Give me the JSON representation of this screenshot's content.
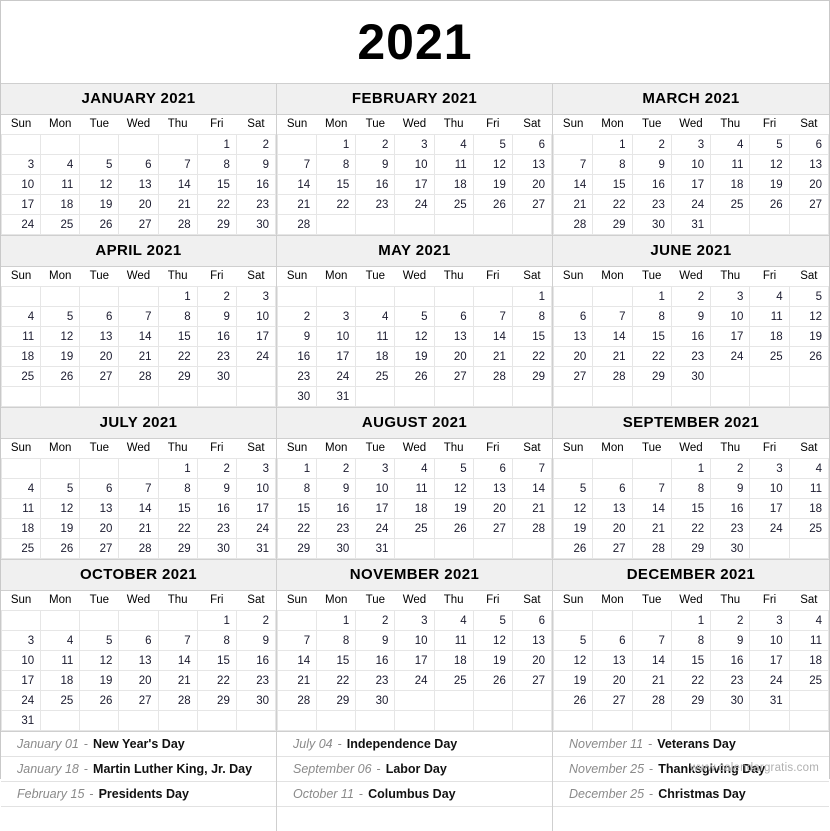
{
  "year_title": "2021",
  "footer": "www.calendargratis.com",
  "weekdays": [
    "Sun",
    "Mon",
    "Tue",
    "Wed",
    "Thu",
    "Fri",
    "Sat"
  ],
  "colors": {
    "header_band": "#f0f0f0",
    "cell_border": "#e6e6e6",
    "month_border": "#cfcfcf",
    "holiday_date": "#8a8a8a",
    "holiday_name": "#111111",
    "footer_text": "#b0b0b0"
  },
  "quarters": [
    {
      "months": [
        {
          "title": "JANUARY 2021",
          "weeks": [
            [
              "",
              "",
              "",
              "",
              "",
              "1",
              "2"
            ],
            [
              "3",
              "4",
              "5",
              "6",
              "7",
              "8",
              "9"
            ],
            [
              "10",
              "11",
              "12",
              "13",
              "14",
              "15",
              "16"
            ],
            [
              "17",
              "18",
              "19",
              "20",
              "21",
              "22",
              "23"
            ],
            [
              "24",
              "25",
              "26",
              "27",
              "28",
              "29",
              "30"
            ]
          ]
        },
        {
          "title": "FEBRUARY 2021",
          "weeks": [
            [
              "",
              "1",
              "2",
              "3",
              "4",
              "5",
              "6"
            ],
            [
              "7",
              "8",
              "9",
              "10",
              "11",
              "12",
              "13"
            ],
            [
              "14",
              "15",
              "16",
              "17",
              "18",
              "19",
              "20"
            ],
            [
              "21",
              "22",
              "23",
              "24",
              "25",
              "26",
              "27"
            ],
            [
              "28",
              "",
              "",
              "",
              "",
              "",
              ""
            ]
          ]
        },
        {
          "title": "MARCH 2021",
          "weeks": [
            [
              "",
              "1",
              "2",
              "3",
              "4",
              "5",
              "6"
            ],
            [
              "7",
              "8",
              "9",
              "10",
              "11",
              "12",
              "13"
            ],
            [
              "14",
              "15",
              "16",
              "17",
              "18",
              "19",
              "20"
            ],
            [
              "21",
              "22",
              "23",
              "24",
              "25",
              "26",
              "27"
            ],
            [
              "28",
              "29",
              "30",
              "31",
              "",
              "",
              ""
            ]
          ]
        }
      ]
    },
    {
      "months": [
        {
          "title": "APRIL 2021",
          "weeks": [
            [
              "",
              "",
              "",
              "",
              "1",
              "2",
              "3"
            ],
            [
              "4",
              "5",
              "6",
              "7",
              "8",
              "9",
              "10"
            ],
            [
              "11",
              "12",
              "13",
              "14",
              "15",
              "16",
              "17"
            ],
            [
              "18",
              "19",
              "20",
              "21",
              "22",
              "23",
              "24"
            ],
            [
              "25",
              "26",
              "27",
              "28",
              "29",
              "30",
              ""
            ],
            [
              "",
              "",
              "",
              "",
              "",
              "",
              ""
            ]
          ]
        },
        {
          "title": "MAY 2021",
          "weeks": [
            [
              "",
              "",
              "",
              "",
              "",
              "",
              "1"
            ],
            [
              "2",
              "3",
              "4",
              "5",
              "6",
              "7",
              "8"
            ],
            [
              "9",
              "10",
              "11",
              "12",
              "13",
              "14",
              "15"
            ],
            [
              "16",
              "17",
              "18",
              "19",
              "20",
              "21",
              "22"
            ],
            [
              "23",
              "24",
              "25",
              "26",
              "27",
              "28",
              "29"
            ],
            [
              "30",
              "31",
              "",
              "",
              "",
              "",
              ""
            ]
          ]
        },
        {
          "title": "JUNE 2021",
          "weeks": [
            [
              "",
              "",
              "1",
              "2",
              "3",
              "4",
              "5"
            ],
            [
              "6",
              "7",
              "8",
              "9",
              "10",
              "11",
              "12"
            ],
            [
              "13",
              "14",
              "15",
              "16",
              "17",
              "18",
              "19"
            ],
            [
              "20",
              "21",
              "22",
              "23",
              "24",
              "25",
              "26"
            ],
            [
              "27",
              "28",
              "29",
              "30",
              "",
              "",
              ""
            ],
            [
              "",
              "",
              "",
              "",
              "",
              "",
              ""
            ]
          ]
        }
      ]
    },
    {
      "months": [
        {
          "title": "JULY 2021",
          "weeks": [
            [
              "",
              "",
              "",
              "",
              "1",
              "2",
              "3"
            ],
            [
              "4",
              "5",
              "6",
              "7",
              "8",
              "9",
              "10"
            ],
            [
              "11",
              "12",
              "13",
              "14",
              "15",
              "16",
              "17"
            ],
            [
              "18",
              "19",
              "20",
              "21",
              "22",
              "23",
              "24"
            ],
            [
              "25",
              "26",
              "27",
              "28",
              "29",
              "30",
              "31"
            ]
          ]
        },
        {
          "title": "AUGUST 2021",
          "weeks": [
            [
              "1",
              "2",
              "3",
              "4",
              "5",
              "6",
              "7"
            ],
            [
              "8",
              "9",
              "10",
              "11",
              "12",
              "13",
              "14"
            ],
            [
              "15",
              "16",
              "17",
              "18",
              "19",
              "20",
              "21"
            ],
            [
              "22",
              "23",
              "24",
              "25",
              "26",
              "27",
              "28"
            ],
            [
              "29",
              "30",
              "31",
              "",
              "",
              "",
              ""
            ]
          ]
        },
        {
          "title": "SEPTEMBER 2021",
          "weeks": [
            [
              "",
              "",
              "",
              "1",
              "2",
              "3",
              "4"
            ],
            [
              "5",
              "6",
              "7",
              "8",
              "9",
              "10",
              "11"
            ],
            [
              "12",
              "13",
              "14",
              "15",
              "16",
              "17",
              "18"
            ],
            [
              "19",
              "20",
              "21",
              "22",
              "23",
              "24",
              "25"
            ],
            [
              "26",
              "27",
              "28",
              "29",
              "30",
              "",
              ""
            ]
          ]
        }
      ]
    },
    {
      "months": [
        {
          "title": "OCTOBER 2021",
          "weeks": [
            [
              "",
              "",
              "",
              "",
              "",
              "1",
              "2"
            ],
            [
              "3",
              "4",
              "5",
              "6",
              "7",
              "8",
              "9"
            ],
            [
              "10",
              "11",
              "12",
              "13",
              "14",
              "15",
              "16"
            ],
            [
              "17",
              "18",
              "19",
              "20",
              "21",
              "22",
              "23"
            ],
            [
              "24",
              "25",
              "26",
              "27",
              "28",
              "29",
              "30"
            ],
            [
              "31",
              "",
              "",
              "",
              "",
              "",
              ""
            ]
          ]
        },
        {
          "title": "NOVEMBER 2021",
          "weeks": [
            [
              "",
              "1",
              "2",
              "3",
              "4",
              "5",
              "6"
            ],
            [
              "7",
              "8",
              "9",
              "10",
              "11",
              "12",
              "13"
            ],
            [
              "14",
              "15",
              "16",
              "17",
              "18",
              "19",
              "20"
            ],
            [
              "21",
              "22",
              "23",
              "24",
              "25",
              "26",
              "27"
            ],
            [
              "28",
              "29",
              "30",
              "",
              "",
              "",
              ""
            ],
            [
              "",
              "",
              "",
              "",
              "",
              "",
              ""
            ]
          ]
        },
        {
          "title": "DECEMBER 2021",
          "weeks": [
            [
              "",
              "",
              "",
              "1",
              "2",
              "3",
              "4"
            ],
            [
              "5",
              "6",
              "7",
              "8",
              "9",
              "10",
              "11"
            ],
            [
              "12",
              "13",
              "14",
              "15",
              "16",
              "17",
              "18"
            ],
            [
              "19",
              "20",
              "21",
              "22",
              "23",
              "24",
              "25"
            ],
            [
              "26",
              "27",
              "28",
              "29",
              "30",
              "31",
              ""
            ],
            [
              "",
              "",
              "",
              "",
              "",
              "",
              ""
            ]
          ]
        }
      ]
    }
  ],
  "holiday_columns": [
    {
      "items": [
        {
          "date": "January 01",
          "dash": "-",
          "name": "New Year's Day"
        },
        {
          "date": "January 18",
          "dash": "-",
          "name": "Martin Luther King, Jr. Day"
        },
        {
          "date": "February 15",
          "dash": "-",
          "name": "Presidents Day"
        }
      ]
    },
    {
      "items": [
        {
          "date": "July 04",
          "dash": "-",
          "name": "Independence Day"
        },
        {
          "date": "September 06",
          "dash": "-",
          "name": "Labor Day"
        },
        {
          "date": "October 11",
          "dash": "-",
          "name": "Columbus Day"
        }
      ]
    },
    {
      "items": [
        {
          "date": "November 11",
          "dash": "-",
          "name": "Veterans Day"
        },
        {
          "date": "November 25",
          "dash": "-",
          "name": "Thanksgiving Day"
        },
        {
          "date": "December 25",
          "dash": "-",
          "name": "Christmas Day"
        }
      ]
    }
  ]
}
